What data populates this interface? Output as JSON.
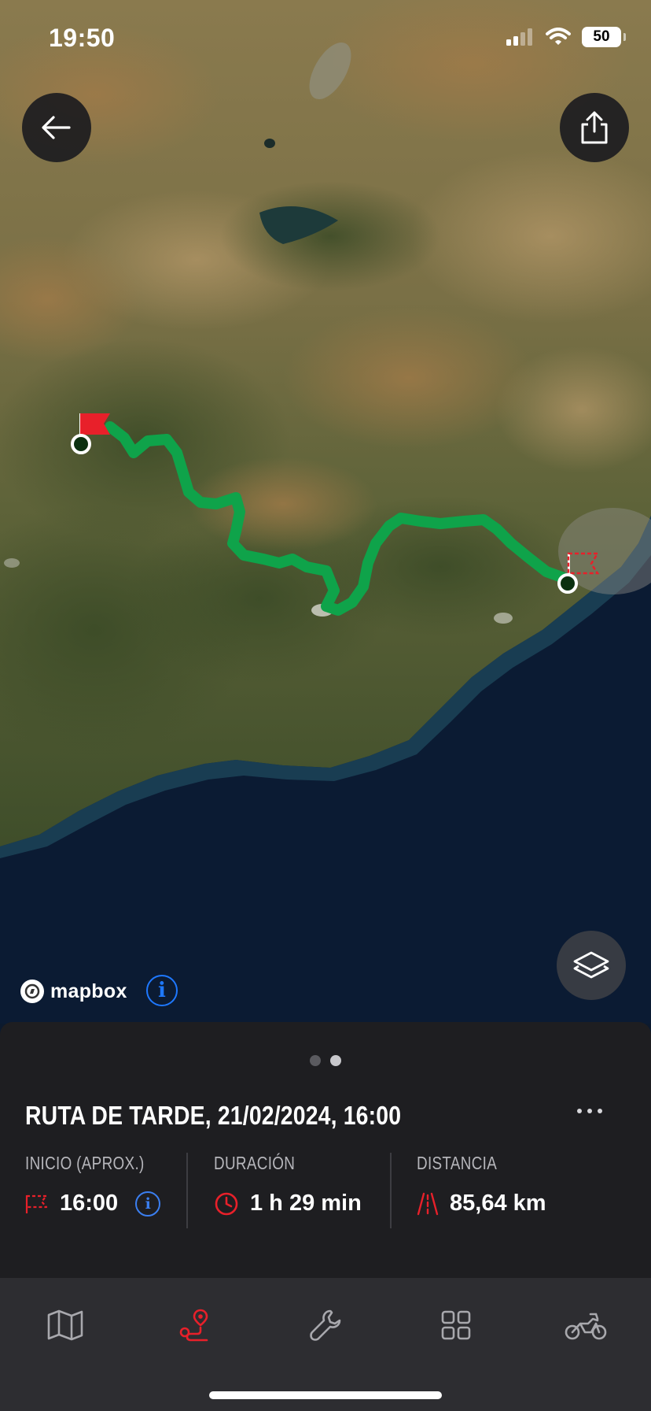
{
  "status_bar": {
    "time": "19:50",
    "battery": "50"
  },
  "map": {
    "attribution": "mapbox",
    "buttons": {
      "back": "arrow-left-icon",
      "share": "share-icon",
      "layers": "layers-icon",
      "info": "info-icon"
    }
  },
  "route": {
    "pager": {
      "pages": 2,
      "active": 2
    },
    "title": "RUTA DE TARDE, 21/02/2024, 16:00",
    "stats": [
      {
        "label": "INICIO (APROX.)",
        "value": "16:00",
        "icon": "start-flag-icon"
      },
      {
        "label": "DURACIÓN",
        "value": "1 h 29 min",
        "icon": "clock-icon"
      },
      {
        "label": "DISTANCIA",
        "value": "85,64 km",
        "icon": "road-icon"
      }
    ]
  },
  "tabbar": {
    "tabs": [
      {
        "icon": "map-icon",
        "active": false
      },
      {
        "icon": "route-icon",
        "active": true
      },
      {
        "icon": "wrench-icon",
        "active": false
      },
      {
        "icon": "grid-icon",
        "active": false
      },
      {
        "icon": "motorcycle-icon",
        "active": false
      }
    ]
  },
  "colors": {
    "route_line": "#0fa34a",
    "accent_red": "#e8202a",
    "info_blue": "#1e78ff",
    "sea": "#0b1b33",
    "sheet_bg": "#1e1e21",
    "tabbar_bg": "#2d2d31"
  }
}
